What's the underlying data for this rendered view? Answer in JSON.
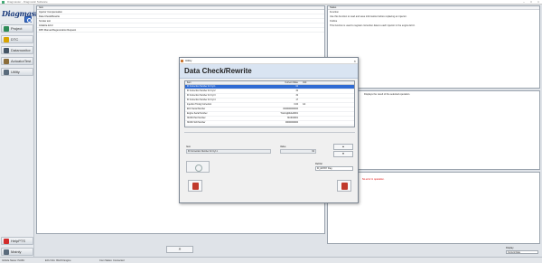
{
  "window": {
    "title": "Diagmaster - Diagnostic Software"
  },
  "sidebar": {
    "logo": "Diagmaster",
    "items": [
      {
        "label": "Project",
        "icon": "folder-icon",
        "color": "#2e8b57"
      },
      {
        "label": "DTC",
        "icon": "dtc-icon",
        "color": "#d9a400"
      },
      {
        "label": "Datamonitor",
        "icon": "monitor-icon",
        "color": "#445566"
      },
      {
        "label": "ActuatorTest",
        "icon": "actuator-icon",
        "color": "#8a6d3b"
      },
      {
        "label": "Utility",
        "icon": "utility-icon",
        "color": "#5a6b7c"
      }
    ],
    "bottom_items": [
      {
        "label": "HelpPTS",
        "icon": "help-icon",
        "color": "#d12b2b"
      },
      {
        "label": "Mainly",
        "icon": "home-icon",
        "color": "#5a6b7c"
      }
    ]
  },
  "main_list": {
    "header": "Item",
    "rows": [
      "Injector Compensation",
      "Data Check/Rewrite",
      "Smoke test",
      "Initialize ECU",
      "DPF Manual Regeneration Request"
    ]
  },
  "next_button": "»",
  "right_panels": {
    "top_header": "Status",
    "top_lines": [
      "Function",
      "Use this function to read and save information before replacing an injector.",
      "Outline",
      "This function is used to register correction data to each injector in the engine ECU."
    ],
    "mid_text": "Displays the result of the selected operation.",
    "bottom_text": "No error in operation."
  },
  "display": {
    "label": "Display",
    "value": "Current Data"
  },
  "status_bar": {
    "left": "Vehicle Name: ISUZU",
    "mid": "ECU Info: ISUZU Engine",
    "right": "Com Status: Connected"
  },
  "dialog": {
    "title": "Utility",
    "heading": "Data Check/Rewrite",
    "grid": {
      "columns": [
        "Item",
        "Current Value",
        "Unit"
      ],
      "rows": [
        {
          "item": "ID Correction Number for Cyl.1",
          "value": "64",
          "unit": "",
          "selected": true
        },
        {
          "item": "ID Correction Number for Cyl.2",
          "value": "32",
          "unit": "",
          "selected": false
        },
        {
          "item": "ID Correction Number for Cyl.3",
          "value": "32",
          "unit": "",
          "selected": false
        },
        {
          "item": "ID Correction Number for Cyl.4",
          "value": "17",
          "unit": "",
          "selected": false
        },
        {
          "item": "Injection Timing Correction",
          "value": "0.00",
          "unit": "CA",
          "selected": false
        },
        {
          "item": "ECU Serial Number",
          "value": "0000000000000",
          "unit": "",
          "selected": false
        },
        {
          "item": "Engine Serial Number",
          "value": "TrainingModel0001",
          "unit": "",
          "selected": false
        },
        {
          "item": "ISUZU Part Number",
          "value": "ISUZU0001",
          "unit": "",
          "selected": false
        },
        {
          "item": "ISUZU Soft Number",
          "value": "00000000000",
          "unit": "",
          "selected": false
        }
      ]
    },
    "item_label": "Item",
    "item_value": "ID Correction Number for Cyl.1",
    "value_label": "Value",
    "value": "64",
    "refval_label": "RefVal",
    "refval_value": "ID_ENTRY Flag",
    "spin_up": "▲",
    "spin_down": "▼",
    "close_icon": "×"
  }
}
